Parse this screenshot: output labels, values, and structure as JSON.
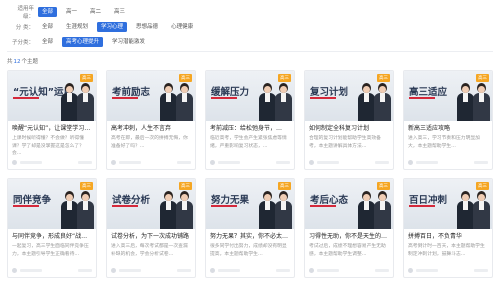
{
  "filters": {
    "grade": {
      "label": "适用年级：",
      "options": [
        "全部",
        "高一",
        "高二",
        "高三"
      ],
      "active": 0
    },
    "category": {
      "label": "分 类：",
      "options": [
        "全部",
        "生涯规划",
        "学习心理",
        "思想品德",
        "心理健康"
      ],
      "active": 2
    },
    "subcategory": {
      "label": "子分类：",
      "options": [
        "全部",
        "高考心理提升",
        "学习潜能激发"
      ],
      "active": 1
    }
  },
  "summary": {
    "prefix": "共",
    "count": "12",
    "suffix": "个主题"
  },
  "colors": {
    "accent": "#2f6fde",
    "badge": "#f5a623",
    "underline": "#d4293b"
  },
  "cards": [
    {
      "thumb_title": "“元认知”运用",
      "badge": "高三",
      "title": "唤醒“元认知”，让课堂学习…",
      "desc": "上课时候听得懂？不会做？听得懂课？学了却是没掌握这是怎么了？会…"
    },
    {
      "thumb_title": "考前励志",
      "badge": "高三",
      "title": "高考冲刺，人生不言弃",
      "desc": "高考在即，最后一次的拼搏无悔，你准备好了吗？…"
    },
    {
      "thumb_title": "缓解压力",
      "badge": "高三",
      "title": "考前减压：给松弛身节，…",
      "desc": "临近高考，学生会产生紧张焦虑等情绪，严重影响复习状态，…"
    },
    {
      "thumb_title": "复习计划",
      "badge": "高三",
      "title": "如何制定全科复习计划",
      "desc": "合理的复习计划能帮助学生高效备考，本主题讲解具体方法…"
    },
    {
      "thumb_title": "高三适应",
      "badge": "高三",
      "title": "新高三适应攻略",
      "desc": "进入高三，学习节奏和压力明显加大，本主题帮助学生…"
    },
    {
      "thumb_title": "同伴竞争",
      "badge": "高三",
      "title": "与同伴竞争，形成良好“战斗…",
      "desc": "一起复习，高三学生面临同伴竞争压力，本主题引导学生正确看待…"
    },
    {
      "thumb_title": "试卷分析",
      "badge": "高三",
      "title": "试卷分析，为下一次成功铺路",
      "desc": "进入高三后，每次考试都是一次查漏补缺的机会，学会分析试卷…"
    },
    {
      "thumb_title": "努力无果",
      "badge": "高三",
      "title": "努力无果？其实，你不必太…",
      "desc": "很多同学付出努力，成绩却没有明显提高，本主题帮助学生…"
    },
    {
      "thumb_title": "考后心态",
      "badge": "高三",
      "title": "习得性无助，你不是天生的…",
      "desc": "考试过后，成绩不理想容易产生无助感，本主题帮助学生调整…"
    },
    {
      "thumb_title": "百日冲刺",
      "badge": "高三",
      "title": "拼搏百日，不负青华",
      "desc": "高考倒计时一百天，本主题帮助学生制定冲刺计划，鼓舞斗志…"
    }
  ]
}
